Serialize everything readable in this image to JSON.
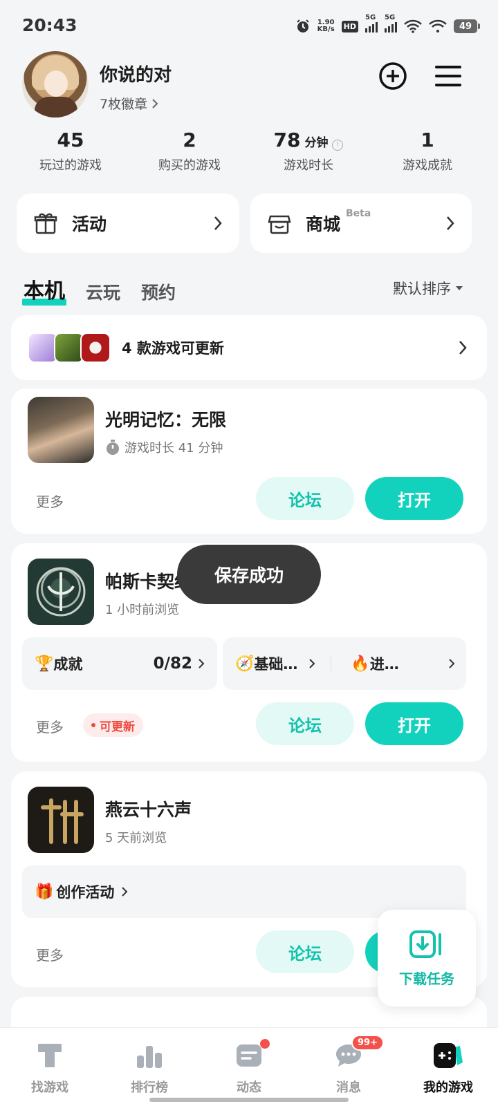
{
  "status_bar": {
    "time": "20:43",
    "net_speed_value": "1.90",
    "net_speed_unit": "KB/s",
    "hd_label": "HD",
    "signal1_label": "5G",
    "signal2_label": "5G",
    "battery": "49"
  },
  "profile": {
    "username": "你说的对",
    "badges": "7枚徽章"
  },
  "stats": [
    {
      "value": "45",
      "unit": "",
      "label": "玩过的游戏"
    },
    {
      "value": "2",
      "unit": "",
      "label": "购买的游戏"
    },
    {
      "value": "78",
      "unit": "分钟",
      "label": "游戏时长"
    },
    {
      "value": "1",
      "unit": "",
      "label": "游戏成就"
    }
  ],
  "entries": {
    "activity": "活动",
    "mall": "商城",
    "mall_beta": "Beta"
  },
  "tabs": [
    "本机",
    "云玩",
    "预约"
  ],
  "sort_label": "默认排序",
  "updates_row": {
    "text": "4 款游戏可更新"
  },
  "games": [
    {
      "name": "光明记忆：无限",
      "sub": "游戏时长 41 分钟",
      "more": "更多",
      "forum": "论坛",
      "open": "打开"
    },
    {
      "name": "帕斯卡契约",
      "sub": "1 小时前浏览",
      "achievement_label": "成就",
      "achievement_value": "0/82",
      "guide1": "基础…",
      "guide2": "进…",
      "more": "更多",
      "update_badge": "可更新",
      "forum": "论坛",
      "open": "打开"
    },
    {
      "name": "燕云十六声",
      "sub": "5 天前浏览",
      "event": "创作活动",
      "more": "更多",
      "forum": "论坛"
    }
  ],
  "toast": "保存成功",
  "fab_label": "下载任务",
  "nav": [
    {
      "label": "找游戏"
    },
    {
      "label": "排行榜"
    },
    {
      "label": "动态"
    },
    {
      "label": "消息",
      "badge": "99+"
    },
    {
      "label": "我的游戏"
    }
  ],
  "colors": {
    "accent": "#13d2bd",
    "accent_light": "#e3f9f5",
    "alert": "#f5514b"
  }
}
